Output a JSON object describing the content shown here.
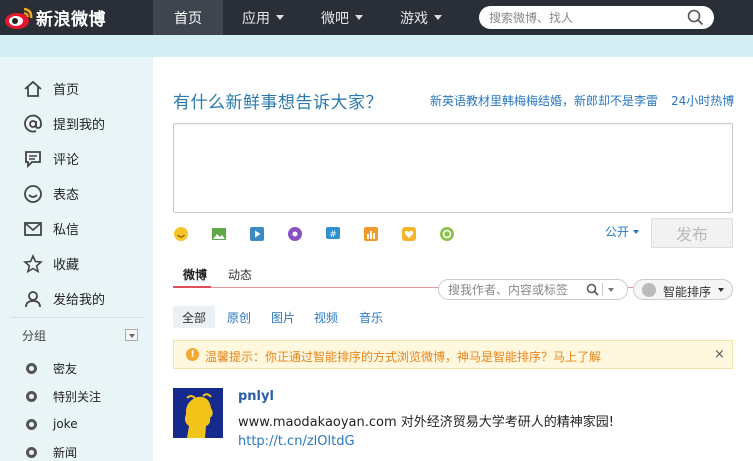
{
  "topbar": {
    "logo_text": "新浪微博",
    "nav": [
      {
        "label": "首页",
        "active": true,
        "dropdown": false
      },
      {
        "label": "应用",
        "active": false,
        "dropdown": true
      },
      {
        "label": "微吧",
        "active": false,
        "dropdown": true
      },
      {
        "label": "游戏",
        "active": false,
        "dropdown": true
      }
    ],
    "search_placeholder": "搜索微博、找人"
  },
  "sidebar": {
    "items": [
      {
        "label": "首页",
        "icon": "home-icon"
      },
      {
        "label": "提到我的",
        "icon": "at-icon"
      },
      {
        "label": "评论",
        "icon": "comment-icon"
      },
      {
        "label": "表态",
        "icon": "smile-icon"
      },
      {
        "label": "私信",
        "icon": "mail-icon"
      },
      {
        "label": "收藏",
        "icon": "star-icon"
      },
      {
        "label": "发给我的",
        "icon": "person-icon"
      }
    ],
    "group_label": "分组",
    "groups": [
      {
        "label": "密友"
      },
      {
        "label": "特别关注"
      },
      {
        "label": "joke"
      },
      {
        "label": "新闻"
      }
    ]
  },
  "composer": {
    "prompt": "有什么新鲜事想告诉大家？",
    "hot_topic": "新英语教材里韩梅梅结婚，新郎却不是李雷",
    "hot_label": "24小时热博",
    "tools": [
      "emoji-icon",
      "image-icon",
      "video-icon",
      "music-icon",
      "topic-icon",
      "poll-icon",
      "like-icon",
      "app-icon"
    ],
    "visibility": "公开",
    "publish_label": "发布"
  },
  "feed": {
    "tabs": [
      "微博",
      "动态"
    ],
    "filter_placeholder": "搜我作者、内容或标签",
    "sort_label": "智能排序",
    "sub_tabs": [
      "全部",
      "原创",
      "图片",
      "视频",
      "音乐"
    ],
    "notice": "温馨提示：你正通过智能排序的方式浏览微博，神马是智能排序？马上了解",
    "notice_close": "×",
    "post": {
      "author": "pnlyl",
      "text": "www.maodakaoyan.com 对外经济贸易大学考研人的精神家园!",
      "link": "http://t.cn/zlOltdG"
    }
  },
  "colors": {
    "topbar": "#2a2f37",
    "accent_blue": "#2a77c2",
    "tab_red": "#e0505a",
    "notice_orange": "#e8841a"
  }
}
